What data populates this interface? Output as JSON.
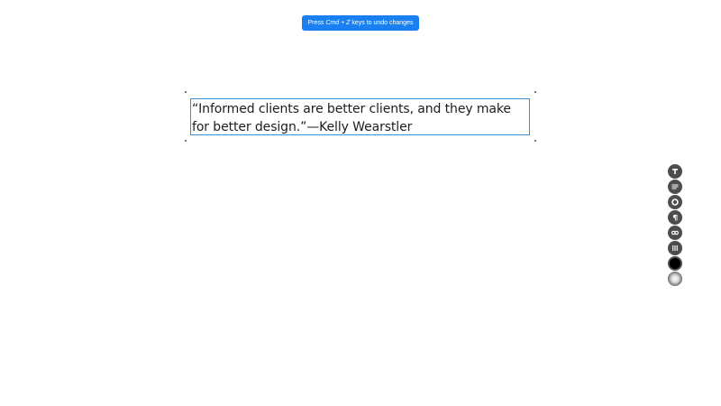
{
  "toast": {
    "prefix": "Press ",
    "shortcut": "Cmd + Z",
    "suffix": " keys to undo changes",
    "color": "#1a7ff0"
  },
  "editor": {
    "quote_text": "“Informed clients are better clients, and they make for better design.”—Kelly Wearstler",
    "selection_color": "#3a8fd8"
  },
  "toolbar": {
    "tools": [
      {
        "icon": "text-type-icon"
      },
      {
        "icon": "align-left-icon"
      },
      {
        "icon": "circle-outline-icon"
      },
      {
        "icon": "paragraph-icon"
      },
      {
        "icon": "link-icon"
      },
      {
        "icon": "columns-icon"
      },
      {
        "icon": "color-black-swatch",
        "color": "#000000"
      },
      {
        "icon": "gradient-swatch"
      }
    ]
  }
}
